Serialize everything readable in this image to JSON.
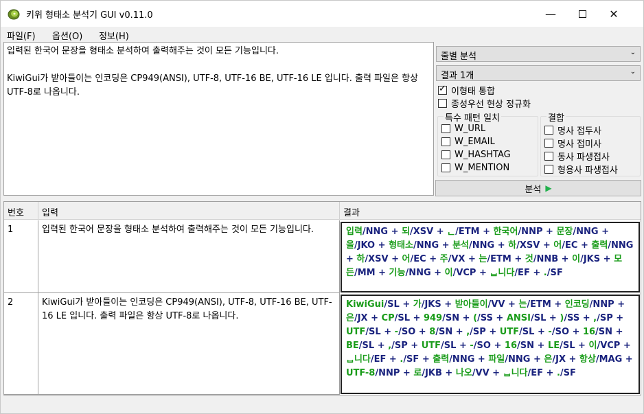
{
  "window": {
    "title": "키위 형태소 분석기 GUI v0.11.0"
  },
  "menu": [
    {
      "label": "파일(F)"
    },
    {
      "label": "옵션(O)"
    },
    {
      "label": "정보(H)"
    }
  ],
  "input_text": "입력된 한국어 문장을 형태소 분석하여 출력해주는 것이 모든 기능입니다.\n\nKiwiGui가 받아들이는 인코딩은 CP949(ANSI), UTF-8, UTF-16 BE, UTF-16 LE 입니다. 출력 파일은 항상 UTF-8로 나옵니다.",
  "options": {
    "mode_select": "줄별 분석",
    "result_count_select": "결과 1개",
    "merge_allomorph": {
      "label": "이형태 통합",
      "checked": true
    },
    "normalize_coda": {
      "label": "종성우선 현상 정규화",
      "checked": false
    },
    "special_pattern": {
      "title": "특수 패턴 일치",
      "items": [
        {
          "label": "W_URL",
          "checked": false
        },
        {
          "label": "W_EMAIL",
          "checked": false
        },
        {
          "label": "W_HASHTAG",
          "checked": false
        },
        {
          "label": "W_MENTION",
          "checked": false
        }
      ]
    },
    "join": {
      "title": "결합",
      "items": [
        {
          "label": "명사 접두사",
          "checked": false
        },
        {
          "label": "명사 접미사",
          "checked": false
        },
        {
          "label": "동사 파생접사",
          "checked": false
        },
        {
          "label": "형용사 파생접사",
          "checked": false
        }
      ]
    },
    "analyze_label": "분석"
  },
  "table": {
    "headers": {
      "num": "번호",
      "input": "입력",
      "result": "결과"
    },
    "rows": [
      {
        "num": "1",
        "input": "입력된 한국어 문장을 형태소 분석하여 출력해주는 것이 모든 기능입니다.",
        "morphs": [
          [
            "입력",
            "NNG"
          ],
          [
            "되",
            "XSV"
          ],
          [
            "ᆫ",
            "ETM"
          ],
          [
            "한국어",
            "NNP"
          ],
          [
            "문장",
            "NNG"
          ],
          [
            "을",
            "JKO"
          ],
          [
            "형태소",
            "NNG"
          ],
          [
            "분석",
            "NNG"
          ],
          [
            "하",
            "XSV"
          ],
          [
            "어",
            "EC"
          ],
          [
            "출력",
            "NNG"
          ],
          [
            "하",
            "XSV"
          ],
          [
            "어",
            "EC"
          ],
          [
            "주",
            "VX"
          ],
          [
            "는",
            "ETM"
          ],
          [
            "것",
            "NNB"
          ],
          [
            "이",
            "JKS"
          ],
          [
            "모든",
            "MM"
          ],
          [
            "기능",
            "NNG"
          ],
          [
            "이",
            "VCP"
          ],
          [
            "ᆸ니다",
            "EF"
          ],
          [
            ".",
            "SF"
          ]
        ]
      },
      {
        "num": "2",
        "input": "KiwiGui가 받아들이는 인코딩은 CP949(ANSI), UTF-8, UTF-16 BE, UTF-16 LE 입니다. 출력 파일은 항상 UTF-8로 나옵니다.",
        "morphs": [
          [
            "KiwiGui",
            "SL"
          ],
          [
            "가",
            "JKS"
          ],
          [
            "받아들이",
            "VV"
          ],
          [
            "는",
            "ETM"
          ],
          [
            "인코딩",
            "NNP"
          ],
          [
            "은",
            "JX"
          ],
          [
            "CP",
            "SL"
          ],
          [
            "949",
            "SN"
          ],
          [
            "(",
            "SS"
          ],
          [
            "ANSI",
            "SL"
          ],
          [
            ")",
            "SS"
          ],
          [
            ",",
            "SP"
          ],
          [
            "UTF",
            "SL"
          ],
          [
            "-",
            "SO"
          ],
          [
            "8",
            "SN"
          ],
          [
            ",",
            "SP"
          ],
          [
            "UTF",
            "SL"
          ],
          [
            "-",
            "SO"
          ],
          [
            "16",
            "SN"
          ],
          [
            "BE",
            "SL"
          ],
          [
            ",",
            "SP"
          ],
          [
            "UTF",
            "SL"
          ],
          [
            "-",
            "SO"
          ],
          [
            "16",
            "SN"
          ],
          [
            "LE",
            "SL"
          ],
          [
            "이",
            "VCP"
          ],
          [
            "ᆸ니다",
            "EF"
          ],
          [
            ".",
            "SF"
          ],
          [
            "출력",
            "NNG"
          ],
          [
            "파일",
            "NNG"
          ],
          [
            "은",
            "JX"
          ],
          [
            "항상",
            "MAG"
          ],
          [
            "UTF-8",
            "NNP"
          ],
          [
            "로",
            "JKB"
          ],
          [
            "나오",
            "VV"
          ],
          [
            "ᆸ니다",
            "EF"
          ],
          [
            ".",
            "SF"
          ]
        ]
      }
    ]
  }
}
